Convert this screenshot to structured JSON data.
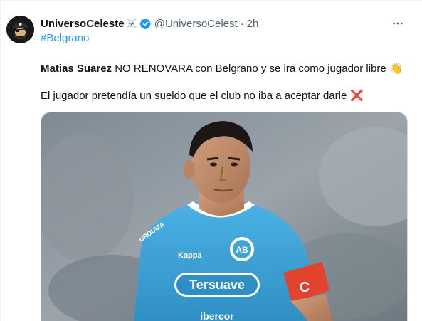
{
  "tweet": {
    "display_name": "UniversoCeleste",
    "name_emoji": "☠️",
    "handle": "@UniversoCelest",
    "separator": "·",
    "time": "2h",
    "hashtag": "#Belgrano",
    "line1_bold": "Matias Suarez",
    "line1_rest": " NO RENOVARA con Belgrano y se ira como jugador libre",
    "line1_emoji": "👋",
    "line2_text": "El jugador pretendía un sueldo que el club no iba a aceptar darle",
    "line2_emoji": "❌",
    "more_label": "···"
  },
  "media": {
    "jersey_sponsor": "Tersuave",
    "jersey_brand": "Kappa",
    "captain_band": "C",
    "crest_letters": "AB",
    "sleeve_text": "UROUIZA",
    "lower_sponsor": "ibercor"
  },
  "colors": {
    "accent": "#1d9bf0",
    "text": "#0f1419",
    "muted": "#536471",
    "jersey": "#3fa4d8",
    "band": "#e2432e"
  },
  "icons": {
    "verified": "verified-badge-icon",
    "more": "more-icon",
    "wave": "waving-hand-icon",
    "cross": "cross-mark-icon"
  }
}
